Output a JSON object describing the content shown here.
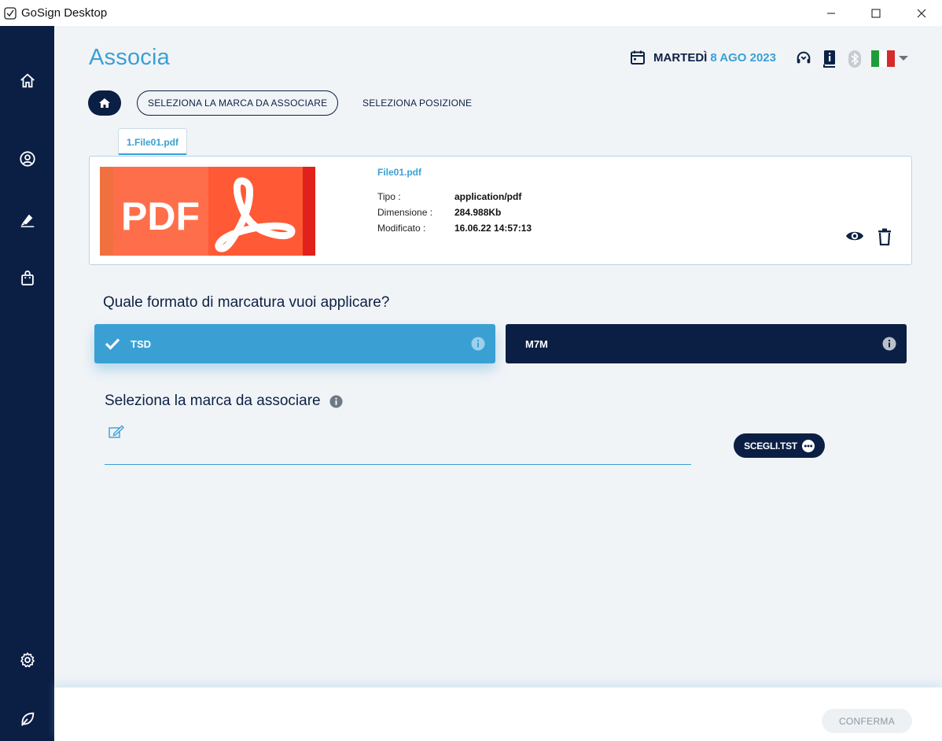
{
  "window": {
    "title": "GoSign Desktop"
  },
  "page": {
    "title": "Associa"
  },
  "header": {
    "weekday": "MARTEDÌ",
    "date": "8 AGO 2023"
  },
  "breadcrumb": {
    "step1": "SELEZIONA LA MARCA DA ASSOCIARE",
    "step2": "SELEZIONA POSIZIONE"
  },
  "file": {
    "tab_label": "1.File01.pdf",
    "name": "File01.pdf",
    "thumb_label": "PDF",
    "meta": [
      {
        "key": "Tipo :",
        "value": "application/pdf"
      },
      {
        "key": "Dimensione :",
        "value": "284.988Kb"
      },
      {
        "key": "Modificato :",
        "value": "16.06.22 14:57:13"
      }
    ]
  },
  "format": {
    "question": "Quale formato di marcatura vuoi applicare?",
    "options": [
      {
        "label": "TSD",
        "selected": true
      },
      {
        "label": "M7M",
        "selected": false
      }
    ]
  },
  "mark": {
    "title": "Seleziona la marca da associare",
    "choose_label": "SCEGLI.TST"
  },
  "footer": {
    "confirm_label": "CONFERMA"
  },
  "colors": {
    "accent": "#3aa0d4",
    "navy": "#0b1f45",
    "pdf_red": "#f05a3c"
  }
}
